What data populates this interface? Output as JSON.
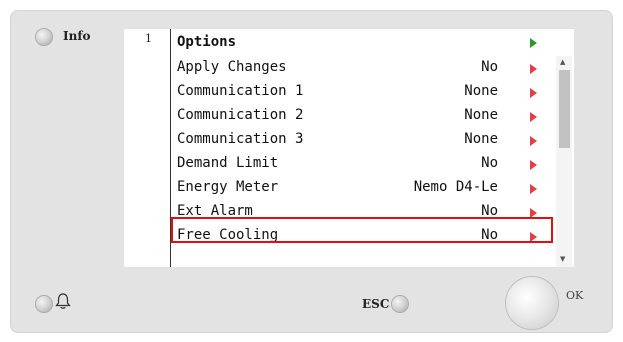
{
  "buttons": {
    "info_label": "Info",
    "esc_label": "ESC",
    "ok_label": "OK"
  },
  "screen": {
    "page_number": "1",
    "title": "Options",
    "rows": [
      {
        "label": "Apply Changes",
        "value": "No"
      },
      {
        "label": "Communication 1",
        "value": "None"
      },
      {
        "label": "Communication 2",
        "value": "None"
      },
      {
        "label": "Communication 3",
        "value": "None"
      },
      {
        "label": "Demand Limit",
        "value": "No"
      },
      {
        "label": "Energy Meter",
        "value": "Nemo D4-Le"
      },
      {
        "label": "Ext Alarm",
        "value": "No"
      },
      {
        "label": "Free Cooling",
        "value": "No"
      }
    ],
    "selected_row": "Ext Alarm"
  },
  "colors": {
    "arrow": "#e04040",
    "header_arrow": "#2a9a2a",
    "highlight": "#e01010"
  },
  "icons": {
    "alarm": "bell-icon",
    "row_arrow": "triangle-right-icon"
  }
}
